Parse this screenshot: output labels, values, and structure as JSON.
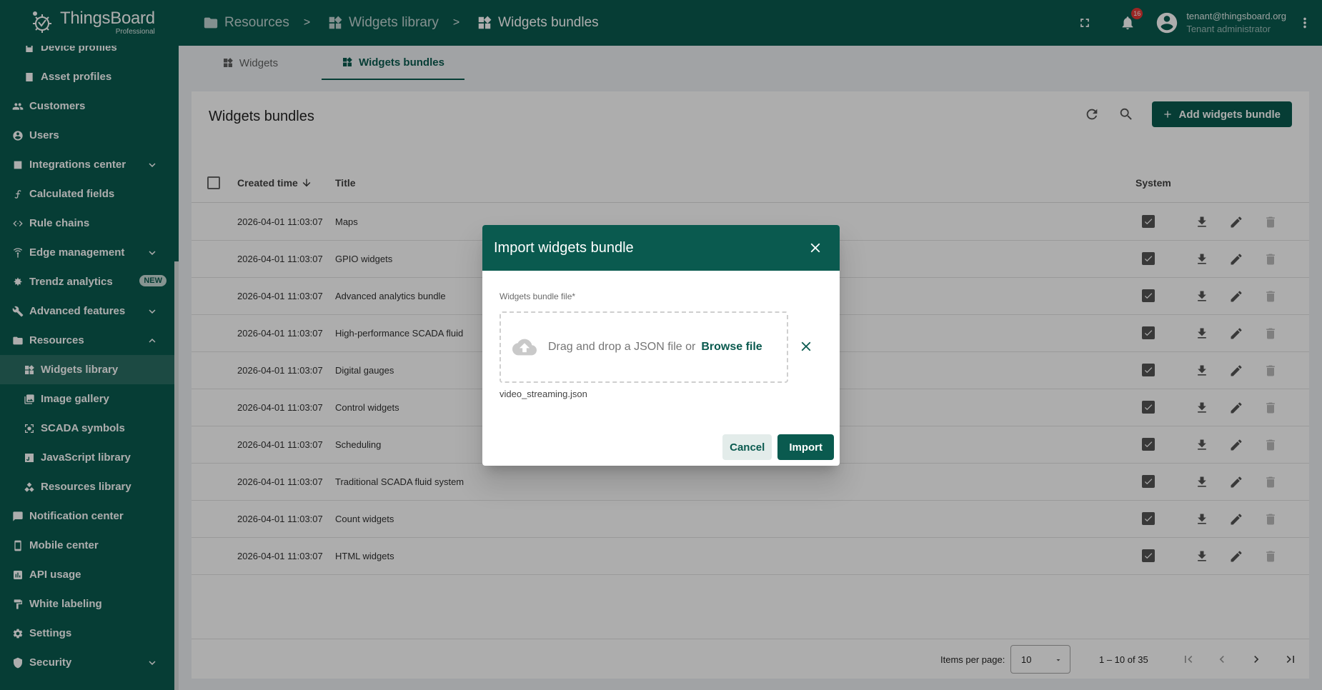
{
  "app": {
    "name": "ThingsBoard",
    "edition": "Professional"
  },
  "breadcrumb": [
    {
      "label": "Resources",
      "icon": "folder-icon"
    },
    {
      "label": "Widgets library",
      "icon": "widgets-icon"
    },
    {
      "label": "Widgets bundles",
      "icon": "widgets-icon"
    }
  ],
  "breadcrumb_separator": ">",
  "header": {
    "notifications": "16",
    "user_email": "tenant@thingsboard.org",
    "user_role": "Tenant administrator"
  },
  "sidebar": {
    "items": [
      {
        "label": "Device profiles",
        "icon": "device-profile-icon",
        "level": "sub"
      },
      {
        "label": "Asset profiles",
        "icon": "asset-profile-icon",
        "level": "sub"
      },
      {
        "label": "Customers",
        "icon": "customers-icon",
        "level": "top"
      },
      {
        "label": "Users",
        "icon": "users-icon",
        "level": "top"
      },
      {
        "label": "Integrations center",
        "icon": "integrations-icon",
        "level": "top",
        "expand": "down"
      },
      {
        "label": "Calculated fields",
        "icon": "function-icon",
        "level": "top"
      },
      {
        "label": "Rule chains",
        "icon": "rule-chain-icon",
        "level": "top"
      },
      {
        "label": "Edge management",
        "icon": "edge-icon",
        "level": "top",
        "expand": "down"
      },
      {
        "label": "Trendz analytics",
        "icon": "trendz-icon",
        "level": "top",
        "badge": "NEW"
      },
      {
        "label": "Advanced features",
        "icon": "tools-icon",
        "level": "top",
        "expand": "down"
      },
      {
        "label": "Resources",
        "icon": "folder-icon",
        "level": "top",
        "expand": "up"
      },
      {
        "label": "Widgets library",
        "icon": "widgets-icon",
        "level": "sub",
        "active": true
      },
      {
        "label": "Image gallery",
        "icon": "image-gallery-icon",
        "level": "sub"
      },
      {
        "label": "SCADA symbols",
        "icon": "scada-icon",
        "level": "sub"
      },
      {
        "label": "JavaScript library",
        "icon": "javascript-icon",
        "level": "sub"
      },
      {
        "label": "Resources library",
        "icon": "resources-library-icon",
        "level": "sub"
      },
      {
        "label": "Notification center",
        "icon": "notification-icon",
        "level": "top"
      },
      {
        "label": "Mobile center",
        "icon": "mobile-icon",
        "level": "top"
      },
      {
        "label": "API usage",
        "icon": "api-usage-icon",
        "level": "top"
      },
      {
        "label": "White labeling",
        "icon": "paint-roller-icon",
        "level": "top"
      },
      {
        "label": "Settings",
        "icon": "settings-icon",
        "level": "top"
      },
      {
        "label": "Security",
        "icon": "security-icon",
        "level": "top",
        "expand": "down"
      }
    ]
  },
  "tabs": [
    {
      "label": "Widgets",
      "active": false
    },
    {
      "label": "Widgets bundles",
      "active": true
    }
  ],
  "card": {
    "title": "Widgets bundles",
    "add_button": "Add widgets bundle"
  },
  "table": {
    "columns": {
      "created": "Created time",
      "title": "Title",
      "system": "System"
    },
    "rows": [
      {
        "created": "2026-04-01 11:03:07",
        "title": "Maps",
        "system": true
      },
      {
        "created": "2026-04-01 11:03:07",
        "title": "GPIO widgets",
        "system": true
      },
      {
        "created": "2026-04-01 11:03:07",
        "title": "Advanced analytics bundle",
        "system": true
      },
      {
        "created": "2026-04-01 11:03:07",
        "title": "High-performance SCADA fluid",
        "system": true
      },
      {
        "created": "2026-04-01 11:03:07",
        "title": "Digital gauges",
        "system": true
      },
      {
        "created": "2026-04-01 11:03:07",
        "title": "Control widgets",
        "system": true
      },
      {
        "created": "2026-04-01 11:03:07",
        "title": "Scheduling",
        "system": true
      },
      {
        "created": "2026-04-01 11:03:07",
        "title": "Traditional SCADA fluid system",
        "system": true
      },
      {
        "created": "2026-04-01 11:03:07",
        "title": "Count widgets",
        "system": true
      },
      {
        "created": "2026-04-01 11:03:07",
        "title": "HTML widgets",
        "system": true
      }
    ]
  },
  "paginator": {
    "label": "Items per page:",
    "page_size": "10",
    "range": "1 – 10 of 35"
  },
  "dialog": {
    "title": "Import widgets bundle",
    "field_label": "Widgets bundle file*",
    "drop_text": "Drag and drop a JSON file or",
    "browse_label": "Browse file",
    "file_name": "video_streaming.json",
    "cancel_label": "Cancel",
    "import_label": "Import"
  },
  "colors": {
    "primary": "#0a5a4f",
    "badge": "#e53935"
  }
}
